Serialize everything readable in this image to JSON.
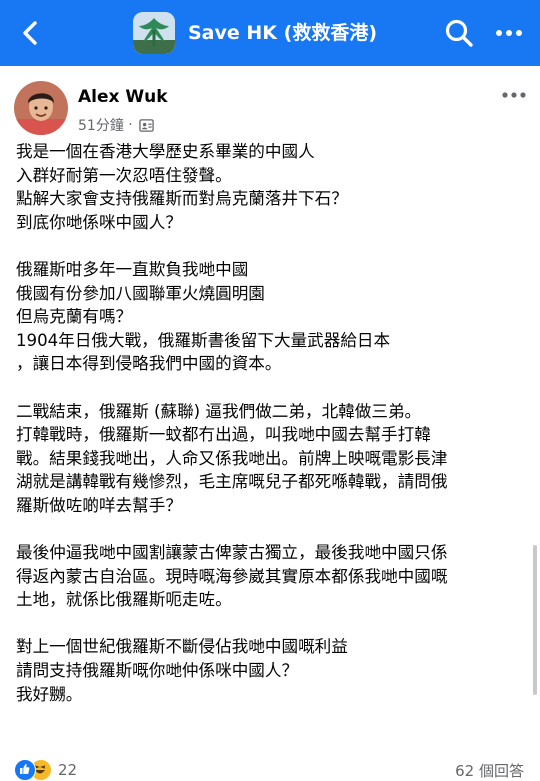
{
  "header": {
    "title": "Save HK (救救香港)",
    "back_icon": "back-arrow-icon",
    "search_icon": "search-icon",
    "more_icon": "more-horizontal-icon",
    "bar_color": "#1877f2"
  },
  "post": {
    "author": "Alex Wuk",
    "time": "51分鐘",
    "separator": "·",
    "audience_icon": "group-audience-icon",
    "more_icon": "more-horizontal-icon",
    "paragraphs": [
      [
        "我是一個在香港大學歷史系畢業的中國人",
        "入群好耐第一次忍唔住發聲。",
        "點解大家會支持俄羅斯而對烏克蘭落井下石？",
        "到底你哋係咪中國人？"
      ],
      [
        "俄羅斯咁多年一直欺負我哋中國",
        "俄國有份參加八國聯軍火燒圓明園",
        "但烏克蘭有嗎？",
        "1904年日俄大戰，俄羅斯書後留下大量武器給日本",
        "，讓日本得到侵略我們中國的資本。"
      ],
      [
        "二戰結束，俄羅斯 (蘇聯) 逼我們做二弟，北韓做三弟。",
        "打韓戰時，俄羅斯一蚊都冇出過，叫我哋中國去幫手打韓",
        "戰。結果錢我哋出，人命又係我哋出。前牌上映嘅電影長津",
        "湖就是講韓戰有幾慘烈，毛主席嘅兒子都死喺韓戰，請問俄",
        "羅斯做咗啲咩去幫手？"
      ],
      [
        "最後仲逼我哋中國割讓蒙古俾蒙古獨立，最後我哋中國只係",
        "得返內蒙古自治區。現時嘅海參崴其實原本都係我哋中國嘅",
        "土地，就係比俄羅斯呃走咗。"
      ],
      [
        "對上一個世紀俄羅斯不斷侵佔我哋中國嘅利益",
        "請問支持俄羅斯嘅你哋仲係咪中國人？",
        "我好嬲。"
      ]
    ]
  },
  "footer": {
    "reaction_icons": [
      "like-icon",
      "haha-icon"
    ],
    "reaction_count": "22",
    "comments": "62 個回答"
  }
}
